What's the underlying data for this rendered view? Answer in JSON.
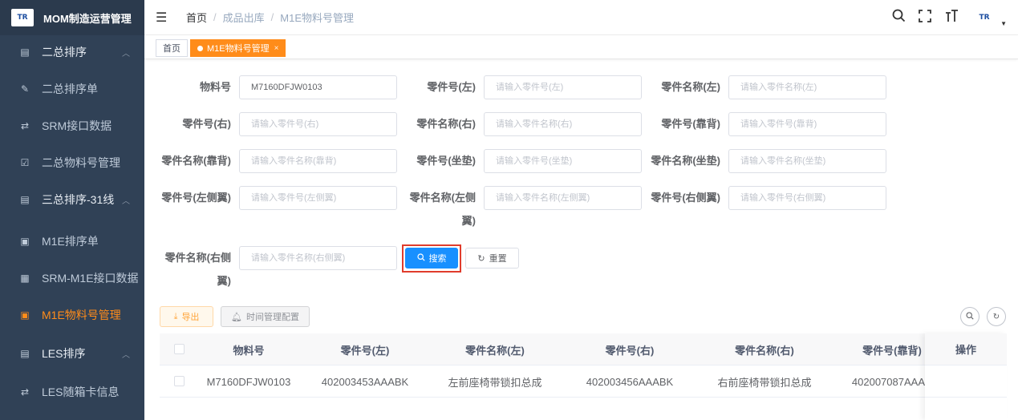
{
  "sidebar": {
    "logo_text": "TR",
    "title": "MOM制造运营管理",
    "items": [
      {
        "label": "二总排序",
        "icon": "list-icon",
        "parent": true
      },
      {
        "label": "二总排序单",
        "icon": "edit-icon"
      },
      {
        "label": "SRM接口数据",
        "icon": "share-icon"
      },
      {
        "label": "二总物料号管理",
        "icon": "checkbox-icon"
      },
      {
        "label": "三总排序-31线",
        "icon": "list-icon",
        "parent": true
      },
      {
        "label": "M1E排序单",
        "icon": "order-icon"
      },
      {
        "label": "SRM-M1E接口数据",
        "icon": "grid-icon"
      },
      {
        "label": "M1E物料号管理",
        "icon": "material-icon",
        "active": true
      },
      {
        "label": "LES排序",
        "icon": "list-icon",
        "parent": true
      },
      {
        "label": "LES随箱卡信息",
        "icon": "share-icon"
      }
    ]
  },
  "header": {
    "breadcrumb": {
      "home": "首页",
      "sep": "/",
      "level1": "成品出库",
      "level2": "M1E物料号管理"
    },
    "avatar_text": "TR"
  },
  "tags": {
    "home": "首页",
    "active": "M1E物料号管理",
    "close": "×"
  },
  "form": {
    "material_no_label": "物料号",
    "material_no_value": "M7160DFJW0103",
    "part_no_left_label": "零件号(左)",
    "part_no_left_ph": "请输入零件号(左)",
    "part_name_left_label": "零件名称(左)",
    "part_name_left_ph": "请输入零件名称(左)",
    "part_no_right_label": "零件号(右)",
    "part_no_right_ph": "请输入零件号(右)",
    "part_name_right_label": "零件名称(右)",
    "part_name_right_ph": "请输入零件名称(右)",
    "part_no_back_label": "零件号(靠背)",
    "part_no_back_ph": "请输入零件号(靠背)",
    "part_name_back_label": "零件名称(靠背)",
    "part_name_back_ph": "请输入零件名称(靠背)",
    "part_no_cushion_label": "零件号(坐垫)",
    "part_no_cushion_ph": "请输入零件号(坐垫)",
    "part_name_cushion_label": "零件名称(坐垫)",
    "part_name_cushion_ph": "请输入零件名称(坐垫)",
    "part_no_lwing_label": "零件号(左侧翼)",
    "part_no_lwing_ph": "请输入零件号(左侧翼)",
    "part_name_lwing_label_1": "零件名称(左侧",
    "part_name_lwing_label_2": "翼)",
    "part_name_lwing_ph": "请输入零件名称(左侧翼)",
    "part_no_rwing_label": "零件号(右侧翼)",
    "part_no_rwing_ph": "请输入零件号(右侧翼)",
    "part_name_rwing_label_1": "零件名称(右侧",
    "part_name_rwing_label_2": "翼)",
    "part_name_rwing_ph": "请输入零件名称(右侧翼)",
    "search_label": "搜索",
    "reset_label": "重置"
  },
  "toolbar": {
    "export_label": "导出",
    "time_config_label": "时间管理配置"
  },
  "table": {
    "columns": [
      "物料号",
      "零件号(左)",
      "零件名称(左)",
      "零件号(右)",
      "零件名称(右)",
      "零件号(靠背)",
      "操作"
    ],
    "rows": [
      [
        "M7160DFJW0103",
        "402003453AAABK",
        "左前座椅带锁扣总成",
        "402003456AAABK",
        "右前座椅带锁扣总成",
        "402007087AAA",
        ""
      ]
    ]
  },
  "colors": {
    "accent": "#ff8c1a",
    "primary": "#1890ff",
    "sidebar_bg": "#304156",
    "highlight": "#e03c2c"
  }
}
